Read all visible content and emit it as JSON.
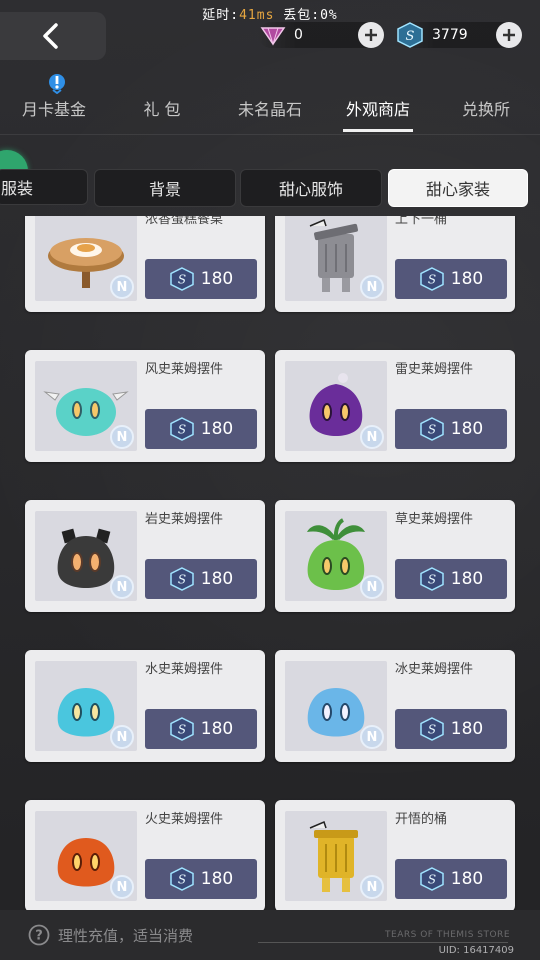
{
  "status": {
    "latency_label": "延时:",
    "latency_value": "41ms",
    "loss_label": "丢包:",
    "loss_value": "0%"
  },
  "currencies": [
    {
      "name": "diamond",
      "amount": "0",
      "color": "#b14aa0"
    },
    {
      "name": "s-crystal",
      "amount": "3779",
      "color": "#4aa8d8"
    }
  ],
  "main_tabs": [
    "月卡基金",
    "礼 包",
    "未名晶石",
    "外观商店",
    "兑换所"
  ],
  "main_tab_active": "外观商店",
  "sub_tabs": [
    "服装",
    "背景",
    "甜心服饰",
    "甜心家装"
  ],
  "sub_tab_active": "甜心家装",
  "products": [
    {
      "name": "浓香蛋糕餐桌",
      "price": "180",
      "rarity": "N",
      "icon": "cake-table-icon"
    },
    {
      "name": "上下一桶",
      "price": "180",
      "rarity": "N",
      "icon": "trash-can-icon"
    },
    {
      "name": "风史莱姆摆件",
      "price": "180",
      "rarity": "N",
      "icon": "wind-slime-icon",
      "color": "#5ad2c8"
    },
    {
      "name": "雷史莱姆摆件",
      "price": "180",
      "rarity": "N",
      "icon": "thunder-slime-icon",
      "color": "#6a2d9a"
    },
    {
      "name": "岩史莱姆摆件",
      "price": "180",
      "rarity": "N",
      "icon": "rock-slime-icon",
      "color": "#3a3a3a"
    },
    {
      "name": "草史莱姆摆件",
      "price": "180",
      "rarity": "N",
      "icon": "grass-slime-icon",
      "color": "#6cc04a"
    },
    {
      "name": "水史莱姆摆件",
      "price": "180",
      "rarity": "N",
      "icon": "water-slime-icon",
      "color": "#4ac6de"
    },
    {
      "name": "冰史莱姆摆件",
      "price": "180",
      "rarity": "N",
      "icon": "ice-slime-icon",
      "color": "#6ab6e8"
    },
    {
      "name": "火史莱姆摆件",
      "price": "180",
      "rarity": "N",
      "icon": "fire-slime-icon",
      "color": "#e05a1e"
    },
    {
      "name": "开悟的桶",
      "price": "180",
      "rarity": "N",
      "icon": "golden-can-icon"
    }
  ],
  "footer": {
    "tip": "理性充值，适当消费",
    "store_name": "TEARS OF THEMIS STORE",
    "uid": "UID: 16417409"
  }
}
